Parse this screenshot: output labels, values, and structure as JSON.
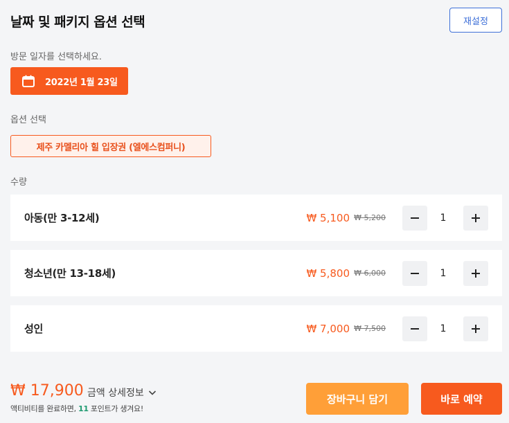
{
  "header": {
    "title": "날짜 및 패키지 옵션 선택",
    "reset_label": "재설정"
  },
  "date_section": {
    "label": "방문 일자를 선택하세요.",
    "selected_date": "2022년 1월 23일",
    "icon": "calendar-icon"
  },
  "option_section": {
    "label": "옵션 선택",
    "selected_option": "제주 카멜리아 힐 입장권 (엘에스컴퍼니)"
  },
  "quantity_section": {
    "label": "수량",
    "items": [
      {
        "name": "아동(만 3-12세)",
        "price": "₩ 5,100",
        "original_price": "₩ 5,200",
        "count": "1"
      },
      {
        "name": "청소년(만 13-18세)",
        "price": "₩ 5,800",
        "original_price": "₩ 6,000",
        "count": "1"
      },
      {
        "name": "성인",
        "price": "₩ 7,000",
        "original_price": "₩ 7,500",
        "count": "1"
      }
    ]
  },
  "footer": {
    "total_price": "₩ 17,900",
    "detail_label": "금액 상세정보",
    "points_prefix": "액티비티를 완료하면,",
    "points_value": "11",
    "points_suffix": "포인트가 생겨요!",
    "cart_label": "장바구니 담기",
    "book_label": "바로 예약"
  },
  "colors": {
    "accent": "#f75a1e",
    "cart": "#ff9f38",
    "link_blue": "#3d6fd8",
    "points_green": "#1f9a70"
  }
}
